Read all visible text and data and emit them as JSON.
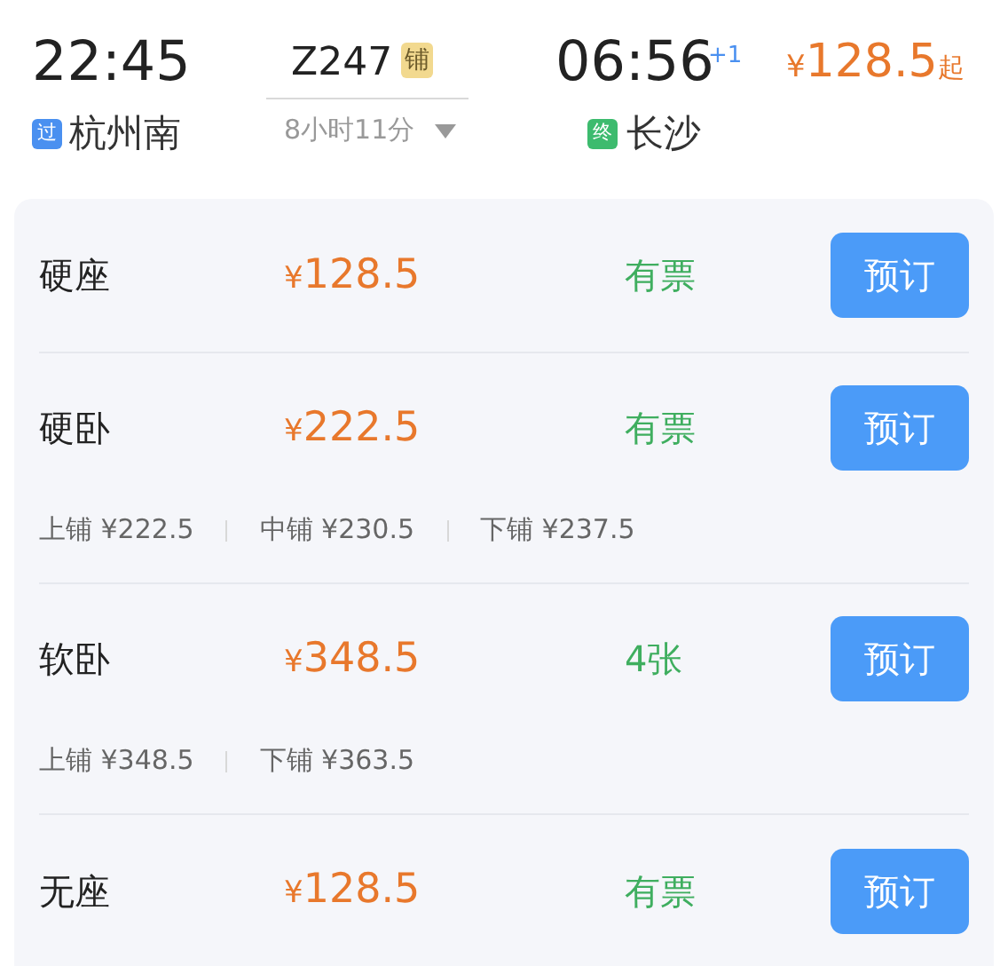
{
  "train": {
    "departure_time": "22:45",
    "departure_badge": {
      "text": "过",
      "color": "#4a90f0"
    },
    "departure_station": "杭州南",
    "number": "Z247",
    "berth_tag": "铺",
    "duration": "8小时11分",
    "arrival_time": "06:56",
    "day_offset": "+1",
    "arrival_badge": {
      "text": "终",
      "color": "#3dbb6e"
    },
    "arrival_station": "长沙",
    "price": {
      "currency": "¥",
      "amount": "128.5",
      "suffix": "起"
    }
  },
  "seats": [
    {
      "name": "硬座",
      "currency": "¥",
      "amount": "128.5",
      "availability": "有票",
      "button": "预订"
    },
    {
      "name": "硬卧",
      "currency": "¥",
      "amount": "222.5",
      "availability": "有票",
      "button": "预订",
      "berths": [
        "上铺 ¥222.5",
        "中铺 ¥230.5",
        "下铺 ¥237.5"
      ]
    },
    {
      "name": "软卧",
      "currency": "¥",
      "amount": "348.5",
      "availability": "4张",
      "button": "预订",
      "berths": [
        "上铺 ¥348.5",
        "下铺 ¥363.5"
      ]
    },
    {
      "name": "无座",
      "currency": "¥",
      "amount": "128.5",
      "availability": "有票",
      "button": "预订"
    }
  ]
}
